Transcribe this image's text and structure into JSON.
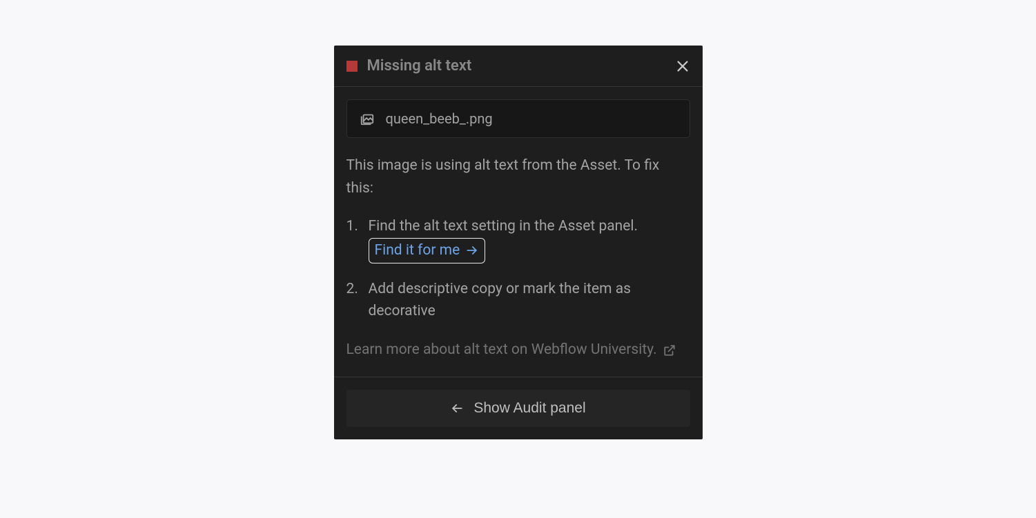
{
  "header": {
    "title": "Missing alt text",
    "status_color": "#b43a3a"
  },
  "file": {
    "name": "queen_beeb_.png"
  },
  "description": "This image is using alt text from the Asset. To fix this:",
  "steps": {
    "step1_prefix": "Find the alt text setting in the Asset panel.",
    "step1_link": "Find it for me",
    "step2": "Add descriptive copy or mark the item as decorative"
  },
  "learn_more": "Learn more about alt text on Webflow University.",
  "footer": {
    "back_label": "Show Audit panel"
  }
}
